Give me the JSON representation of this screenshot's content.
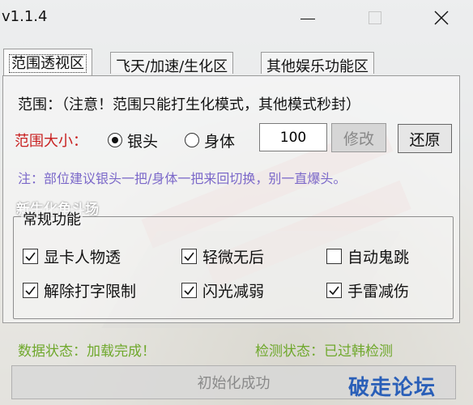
{
  "window": {
    "title": "v1.1.4"
  },
  "tabs": [
    {
      "label": "范围透视区",
      "active": true
    },
    {
      "label": "飞天/加速/生化区",
      "active": false
    },
    {
      "label": "其他娱乐功能区",
      "active": false
    }
  ],
  "range": {
    "notice": "范围：（注意！范围只能打生化模式，其他模式秒封）",
    "size_label": "范围大小：",
    "options": [
      {
        "label": "银头",
        "selected": true
      },
      {
        "label": "身体",
        "selected": false
      }
    ],
    "value": "100",
    "modify_label": "修改",
    "restore_label": "还原",
    "tip": "注：部位建议银头一把/身体一把来回切换，别一直爆头。"
  },
  "overlay_text": "新生化角斗场",
  "general": {
    "title": "常规功能",
    "checkboxes": [
      {
        "label": "显卡人物透",
        "checked": true
      },
      {
        "label": "轻微无后",
        "checked": true
      },
      {
        "label": "自动鬼跳",
        "checked": false
      },
      {
        "label": "解除打字限制",
        "checked": true
      },
      {
        "label": "闪光减弱",
        "checked": true
      },
      {
        "label": "手雷减伤",
        "checked": true
      }
    ]
  },
  "status": {
    "data": "数据状态：加载完成！",
    "detect": "检测状态：已过韩检测"
  },
  "init_button": "初始化成功",
  "watermark": "破走论坛",
  "colors": {
    "size_label": "#c81f1f",
    "tip": "#7b68c9",
    "status": "#6fa82c",
    "watermark": "#2a5fb8"
  }
}
